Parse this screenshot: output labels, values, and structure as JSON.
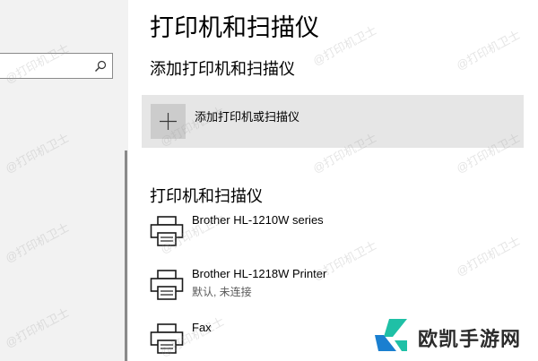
{
  "header": {
    "page_title": "打印机和扫描仪"
  },
  "search": {
    "value": "",
    "placeholder": ""
  },
  "add_section": {
    "title": "添加打印机和扫描仪",
    "button_label": "添加打印机或扫描仪"
  },
  "printers_section": {
    "title": "打印机和扫描仪",
    "items": [
      {
        "name": "Brother HL-1210W series",
        "status": ""
      },
      {
        "name": "Brother HL-1218W Printer",
        "status": "默认, 未连接"
      },
      {
        "name": "Fax",
        "status": ""
      }
    ]
  },
  "watermark": {
    "text": "@打印机卫士"
  },
  "brand": {
    "name": "欧凯手游网",
    "colors": {
      "primary": "#1fc0a6",
      "secondary": "#1a7fd0"
    }
  },
  "colors": {
    "left_pane": "#f2f2f2",
    "card_bg": "#e6e6e6",
    "icon_box_bg": "#cccccc"
  },
  "icons": {
    "search": "search-icon",
    "add": "plus-icon",
    "printer": "printer-icon"
  }
}
